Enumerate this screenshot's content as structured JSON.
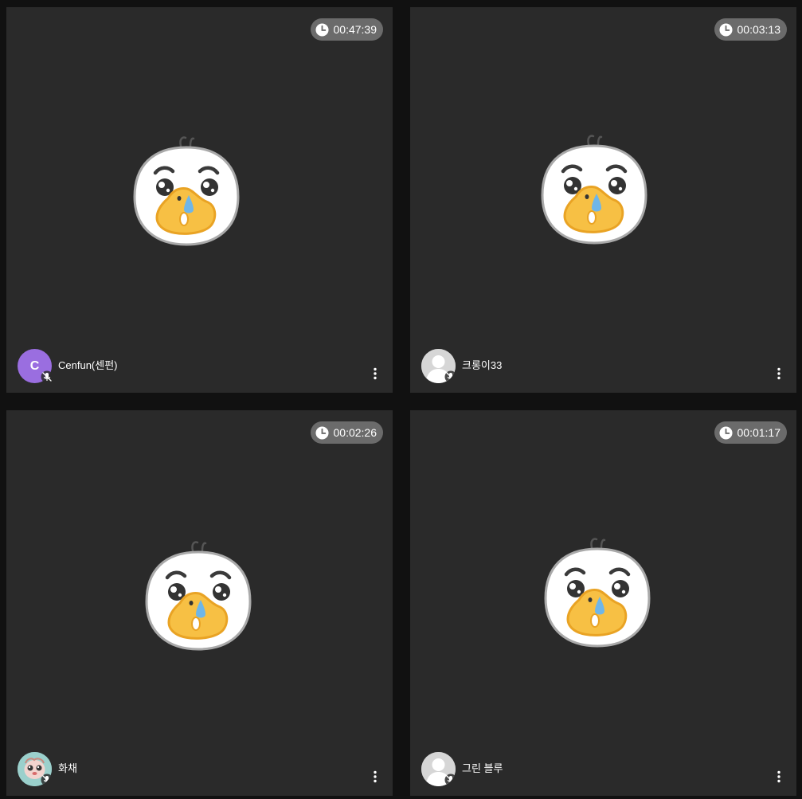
{
  "tiles": [
    {
      "timer": "00:47:39",
      "user": {
        "name": "Cenfun(센펀)",
        "avatar_type": "letter",
        "avatar_letter": "C",
        "avatar_color": "#9a6ee0",
        "mic": "muted"
      }
    },
    {
      "timer": "00:03:13",
      "user": {
        "name": "크롱이33",
        "avatar_type": "silhouette",
        "mic": "muted"
      }
    },
    {
      "timer": "00:02:26",
      "user": {
        "name": "화채",
        "avatar_type": "sticker",
        "mic": "muted"
      }
    },
    {
      "timer": "00:01:17",
      "user": {
        "name": "그린 블루",
        "avatar_type": "silhouette",
        "mic": "muted"
      }
    }
  ],
  "icons": {
    "timer": "clock-icon",
    "mic": "mic-off-icon",
    "menu": "more-vertical-icon",
    "placeholder": "crying-bird-mascot"
  },
  "colors": {
    "background": "#111111",
    "tile": "#2a2a2a",
    "timer_pill": "#6b6b6b",
    "avatar_letter_bg": "#9a6ee0"
  }
}
